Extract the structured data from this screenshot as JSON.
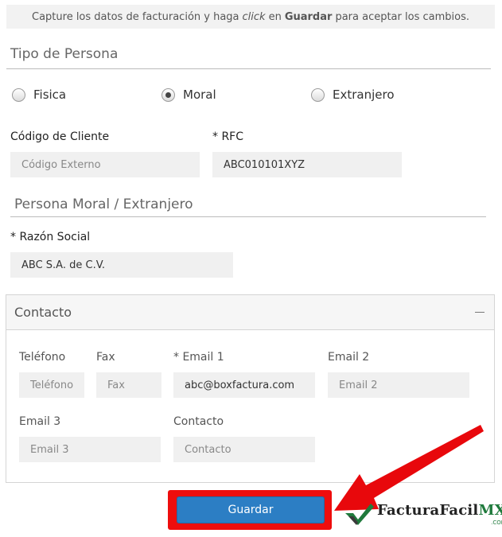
{
  "notice": {
    "before": "Capture los datos de facturación y haga",
    "click_word": "click",
    "middle": "en",
    "save_word": "Guardar",
    "after": "para aceptar los cambios."
  },
  "tipo_persona": {
    "title": "Tipo de Persona",
    "options": [
      {
        "label": "Fisica",
        "selected": false
      },
      {
        "label": "Moral",
        "selected": true
      },
      {
        "label": "Extranjero",
        "selected": false
      }
    ]
  },
  "cliente": {
    "codigo_label": "Código de Cliente",
    "codigo_placeholder": "Código Externo",
    "codigo_value": "",
    "rfc_label": "* RFC",
    "rfc_value": "ABC010101XYZ"
  },
  "persona_moral": {
    "title": "Persona Moral / Extranjero",
    "razon_label": "* Razón Social",
    "razon_value": "ABC S.A. de C.V."
  },
  "contacto": {
    "title": "Contacto",
    "collapse_icon": "minus-icon",
    "telefono_label": "Teléfono",
    "telefono_placeholder": "Teléfono",
    "fax_label": "Fax",
    "fax_placeholder": "Fax",
    "email1_label": "* Email 1",
    "email1_value": "abc@boxfactura.com",
    "email2_label": "Email 2",
    "email2_placeholder": "Email 2",
    "email3_label": "Email 3",
    "email3_placeholder": "Email 3",
    "contacto_label": "Contacto",
    "contacto_placeholder": "Contacto"
  },
  "actions": {
    "save_label": "Guardar"
  },
  "brand": {
    "name_main": "FacturaFacil",
    "name_suffix": "MX",
    "sub": ".COM"
  },
  "colors": {
    "primary_button": "#2c7ec4",
    "highlight": "#ee0d0d",
    "field_bg": "#f0f0f0",
    "brand_green": "#1f7a3c"
  }
}
